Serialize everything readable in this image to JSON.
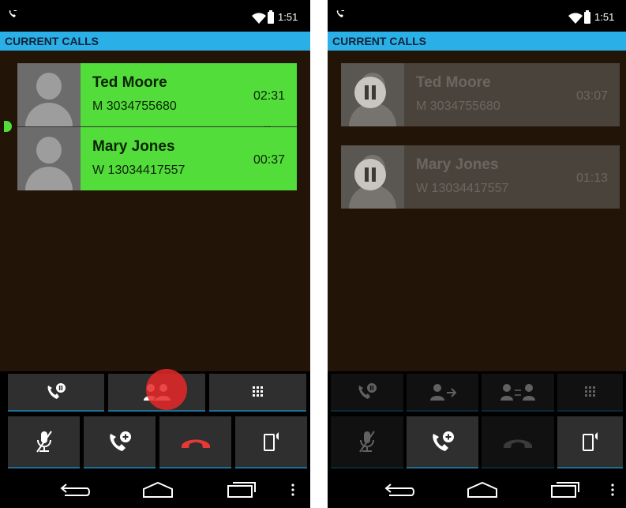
{
  "left_screen": {
    "status_bar": {
      "time": "1:51",
      "notification_icon": "call-in-progress-icon"
    },
    "header_title": "CURRENT CALLS",
    "calls": [
      {
        "name": "Ted Moore",
        "number": "M 3034755680",
        "duration": "02:31",
        "state": "active-conference"
      },
      {
        "name": "Mary Jones",
        "number": "W 13034417557",
        "duration": "00:37",
        "state": "active-conference"
      }
    ],
    "row1_buttons": [
      "hold-call-icon",
      "split-conference-icon",
      "dialpad-icon"
    ],
    "row2_buttons": [
      "mute-mic-icon",
      "add-call-icon",
      "end-call-icon",
      "audio-route-icon"
    ]
  },
  "right_screen": {
    "status_bar": {
      "time": "1:51",
      "notification_icon": "call-in-progress-icon"
    },
    "header_title": "CURRENT CALLS",
    "calls": [
      {
        "name": "Ted Moore",
        "number": "M 3034755680",
        "duration": "03:07",
        "state": "on-hold"
      },
      {
        "name": "Mary Jones",
        "number": "W 13034417557",
        "duration": "01:13",
        "state": "on-hold"
      }
    ],
    "row1_buttons": [
      "hold-call-icon",
      "transfer-call-icon",
      "merge-calls-icon",
      "dialpad-icon"
    ],
    "row2_buttons": [
      "mute-mic-icon",
      "add-call-icon",
      "end-call-icon",
      "audio-route-icon"
    ]
  },
  "colors": {
    "header": "#2ab0e6",
    "active_call": "#52dd3b",
    "held_call": "#4a433c",
    "end_call": "#e53935",
    "background": "#231408"
  }
}
